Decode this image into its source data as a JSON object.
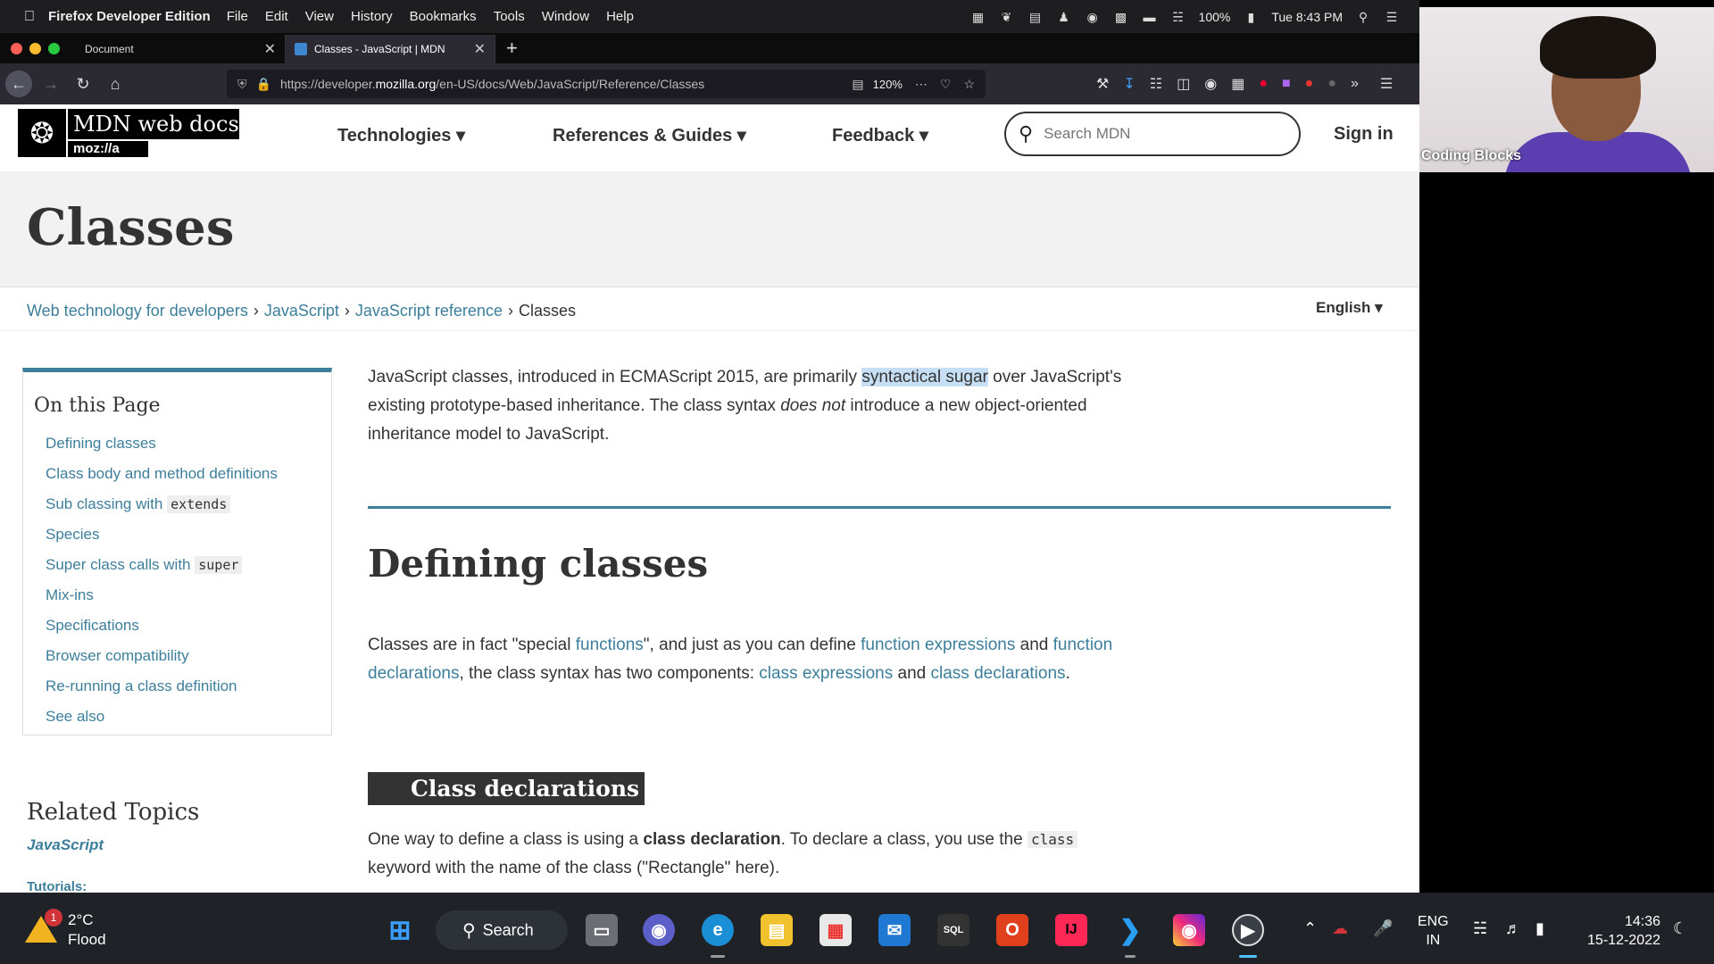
{
  "menubar": {
    "app_name": "Firefox Developer Edition",
    "menus": [
      "File",
      "Edit",
      "View",
      "History",
      "Bookmarks",
      "Tools",
      "Window",
      "Help"
    ],
    "battery": "100%",
    "datetime": "Tue 8:43 PM"
  },
  "tabs": [
    {
      "title": "Document"
    },
    {
      "title": "Classes - JavaScript | MDN"
    }
  ],
  "navbar": {
    "url_prefix": "https://developer.",
    "url_domain": "mozilla.org",
    "url_path": "/en-US/docs/Web/JavaScript/Reference/Classes",
    "zoom": "120%"
  },
  "mdn": {
    "logo_wordmark": "MDN web docs",
    "logo_moz": "moz://a",
    "nav": [
      "Technologies ▾",
      "References & Guides ▾",
      "Feedback ▾"
    ],
    "search_placeholder": "Search MDN",
    "sign_in": "Sign in",
    "title": "Classes",
    "breadcrumbs": [
      "Web technology for developers",
      "JavaScript",
      "JavaScript reference"
    ],
    "breadcrumb_current": "Classes",
    "language": "English ▾"
  },
  "toc": {
    "heading": "On this Page",
    "items": [
      {
        "label": "Defining classes",
        "code": ""
      },
      {
        "label": "Class body and method definitions",
        "code": ""
      },
      {
        "label": "Sub classing with ",
        "code": "extends"
      },
      {
        "label": "Species",
        "code": ""
      },
      {
        "label": "Super class calls with ",
        "code": "super"
      },
      {
        "label": "Mix-ins",
        "code": ""
      },
      {
        "label": "Specifications",
        "code": ""
      },
      {
        "label": "Browser compatibility",
        "code": ""
      },
      {
        "label": "Re-running a class definition",
        "code": ""
      },
      {
        "label": "See also",
        "code": ""
      }
    ],
    "related_heading": "Related Topics",
    "related_js": "JavaScript",
    "tutorials": "Tutorials:"
  },
  "content": {
    "intro_1": "JavaScript classes, introduced in ECMAScript 2015, are primarily ",
    "intro_selected": "syntactical sugar",
    "intro_2": " over JavaScript's existing prototype-based inheritance. The class syntax ",
    "intro_em": "does not",
    "intro_3": " introduce a new object-oriented inheritance model to JavaScript.",
    "h2": "Defining classes",
    "p2_a": "Classes are in fact \"special ",
    "p2_link1": "functions",
    "p2_b": "\", and just as you can define ",
    "p2_link2": "function expressions",
    "p2_c": " and ",
    "p2_link3": "function declarations",
    "p2_d": ", the class syntax has two components: ",
    "p2_link4": "class expressions",
    "p2_e": " and ",
    "p2_link5": "class declarations",
    "p2_f": ".",
    "h3": "Class declarations",
    "p3_a": "One way to define a class is using a ",
    "p3_strong": "class declaration",
    "p3_b": ". To declare a class, you use the ",
    "p3_code": "class",
    "p3_c": " keyword with the name of the class (\"Rectangle\" here)."
  },
  "webcam": {
    "name": "Coding Blocks"
  },
  "taskbar": {
    "weather_badge": "1",
    "weather_temp": "2°C",
    "weather_desc": "Flood",
    "search_label": "Search",
    "lang_line1": "ENG",
    "lang_line2": "IN",
    "time": "14:36",
    "date": "15-12-2022"
  },
  "colors": {
    "mdn_link": "#3d7e9a",
    "selection": "#c7dff4",
    "browser_chrome": "#2b2a33"
  }
}
